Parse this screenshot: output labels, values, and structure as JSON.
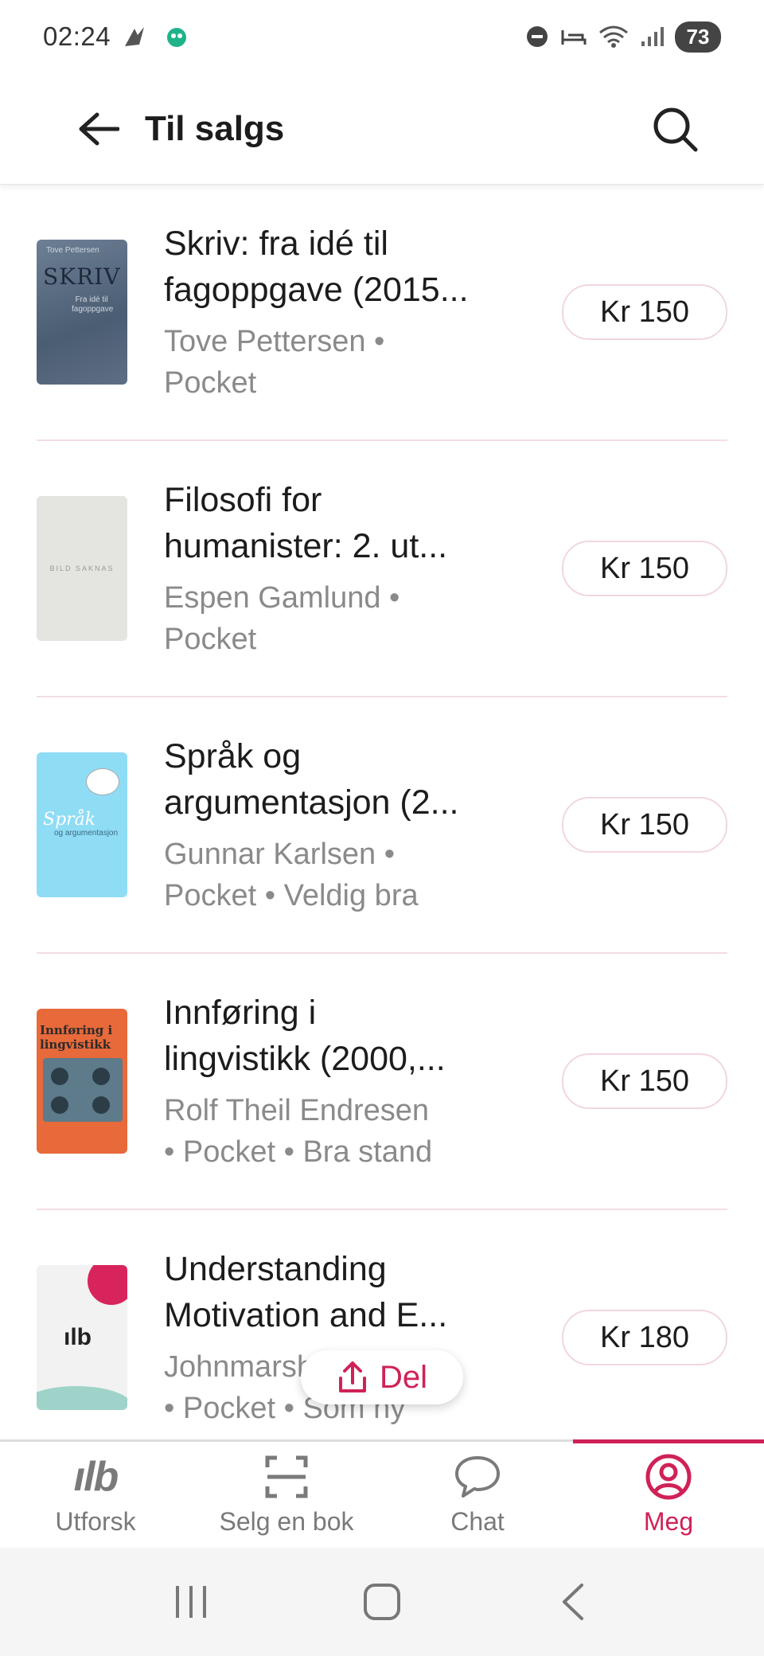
{
  "status_bar": {
    "time": "02:24",
    "battery": "73"
  },
  "app_bar": {
    "title": "Til salgs"
  },
  "books": [
    {
      "title_line1": "Skriv: fra idé til",
      "title_line2": "fagoppgave (2015...",
      "meta_line1": "Tove Pettersen •",
      "meta_line2": "Pocket",
      "price": "Kr 150",
      "cover_text": "SKRIV"
    },
    {
      "title_line1": "Filosofi for",
      "title_line2": "humanister: 2. ut...",
      "meta_line1": "Espen Gamlund •",
      "meta_line2": "Pocket",
      "price": "Kr 150",
      "cover_text": "BILD SAKNAS"
    },
    {
      "title_line1": "Språk og",
      "title_line2": "argumentasjon (2...",
      "meta_line1": "Gunnar Karlsen •",
      "meta_line2": "Pocket • Veldig bra",
      "price": "Kr 150",
      "cover_text": "Språk"
    },
    {
      "title_line1": "Innføring i",
      "title_line2": "lingvistikk (2000,...",
      "meta_line1": "Rolf Theil Endresen",
      "meta_line2": "• Pocket • Bra stand",
      "price": "Kr 150",
      "cover_text": "Innføring i lingvistikk"
    },
    {
      "title_line1": "Understanding",
      "title_line2": "Motivation and E...",
      "meta_line1": "Johnmarshall Reeve",
      "meta_line2": "• Pocket • Som ny",
      "price": "Kr 180",
      "cover_text": "ılb"
    }
  ],
  "share_button": {
    "label": "Del"
  },
  "bottom_nav": [
    {
      "label": "Utforsk",
      "icon": "ilb-logo-icon"
    },
    {
      "label": "Selg en bok",
      "icon": "scan-icon"
    },
    {
      "label": "Chat",
      "icon": "chat-bubble-icon"
    },
    {
      "label": "Meg",
      "icon": "profile-icon",
      "active": true
    }
  ],
  "colors": {
    "accent": "#cf2257",
    "divider": "#f3dde3",
    "secondary_text": "#8a8a8a"
  }
}
